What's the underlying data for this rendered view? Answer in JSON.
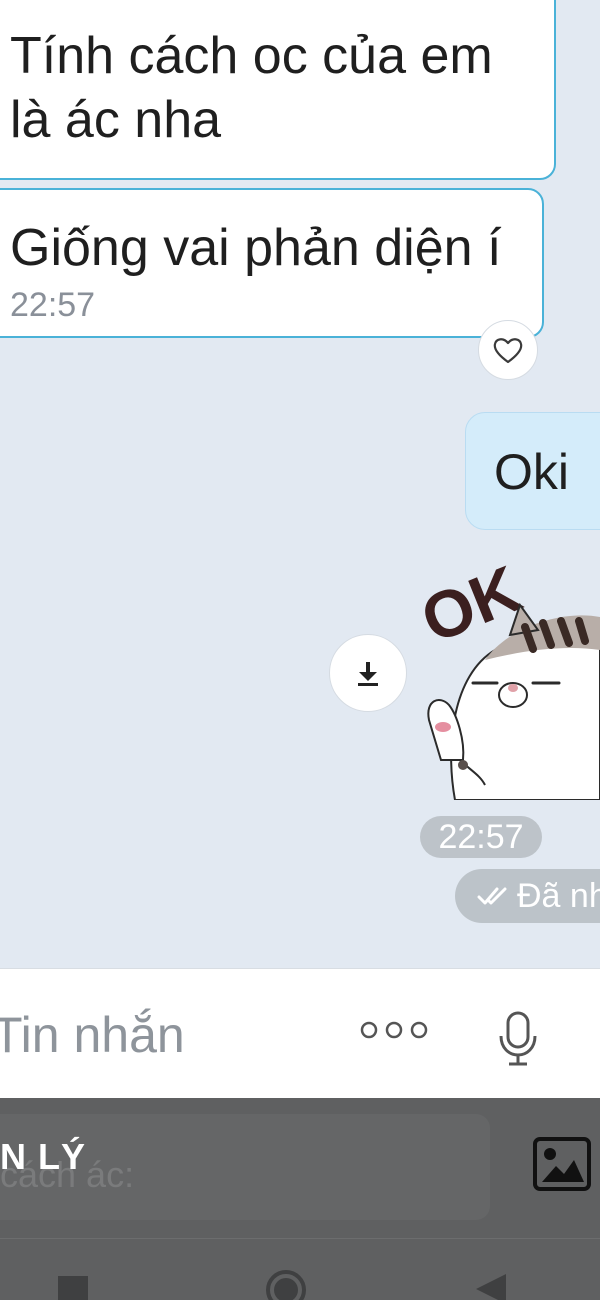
{
  "messages": [
    {
      "direction": "incoming",
      "text_lines": [
        "Tính cách oc của em",
        "là ác nha"
      ]
    },
    {
      "direction": "incoming",
      "text": "Giống vai phản diện í",
      "time": "22:57",
      "reaction_icon": "heart-outline-icon"
    },
    {
      "direction": "outgoing",
      "text": "Oki"
    },
    {
      "direction": "outgoing",
      "type": "sticker",
      "sticker_text": "OK",
      "time": "22:57",
      "status": "Đã nh"
    }
  ],
  "composer": {
    "placeholder": "Tin nhắn",
    "more_icon": "more-dots-icon",
    "mic_icon": "microphone-icon"
  },
  "overlay": {
    "title": "N LÝ",
    "input_placeholder": "cách ác:",
    "image_icon": "image-icon"
  },
  "colors": {
    "chat_background": "#e2e9f2",
    "incoming_bubble_border": "#4ab2d8",
    "outgoing_bubble": "#d4ecfa",
    "overlay": "#5f6061"
  }
}
